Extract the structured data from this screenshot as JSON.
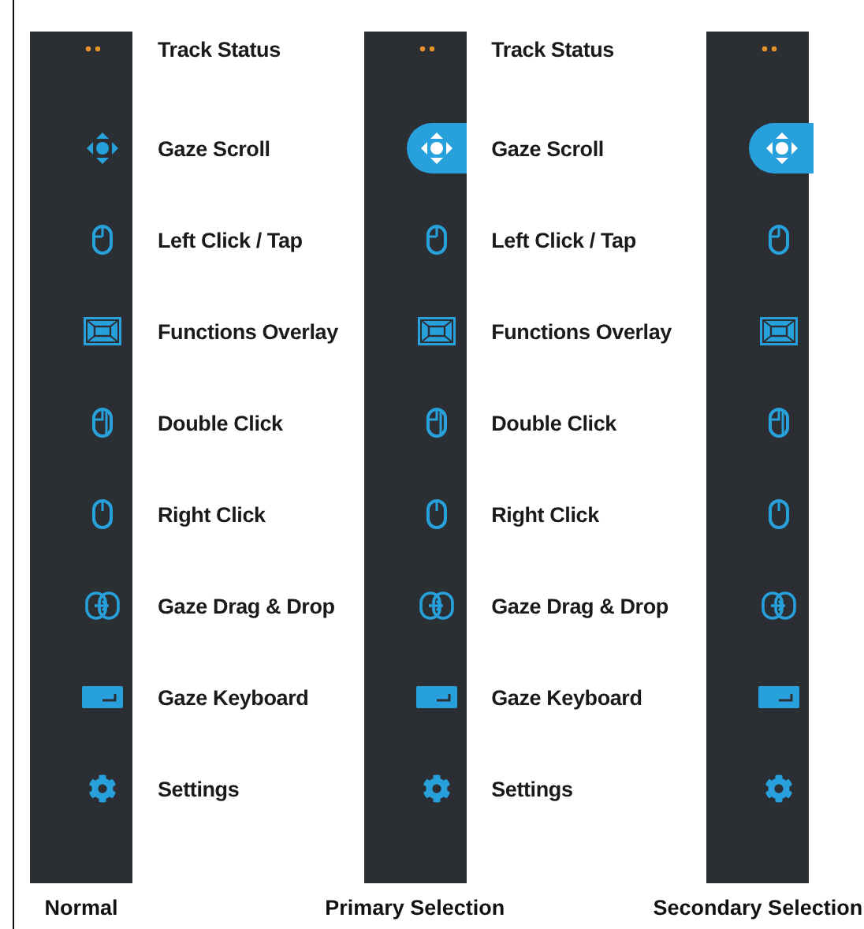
{
  "panels": [
    {
      "caption": "Normal",
      "kind": "normal",
      "items": [
        {
          "kind": "status",
          "label": "Track Status",
          "selected": false
        },
        {
          "kind": "scroll",
          "label": "Gaze Scroll",
          "selected": false
        },
        {
          "kind": "left-click",
          "label": "Left Click / Tap",
          "selected": false
        },
        {
          "kind": "overlay",
          "label": "Functions Overlay",
          "selected": false
        },
        {
          "kind": "double-click",
          "label": "Double Click",
          "selected": false
        },
        {
          "kind": "right-click",
          "label": "Right Click",
          "selected": false
        },
        {
          "kind": "drag-drop",
          "label": "Gaze Drag & Drop",
          "selected": false
        },
        {
          "kind": "keyboard",
          "label": "Gaze Keyboard",
          "selected": false
        },
        {
          "kind": "settings",
          "label": "Settings",
          "selected": false
        }
      ]
    },
    {
      "caption": "Primary Selection",
      "kind": "primary",
      "items": [
        {
          "kind": "status",
          "label": "Track Status",
          "selected": false
        },
        {
          "kind": "scroll",
          "label": "Gaze Scroll",
          "selected": true
        },
        {
          "kind": "left-click",
          "label": "Left Click / Tap",
          "selected": false
        },
        {
          "kind": "overlay",
          "label": "Functions Overlay",
          "selected": false
        },
        {
          "kind": "double-click",
          "label": "Double Click",
          "selected": false
        },
        {
          "kind": "right-click",
          "label": "Right Click",
          "selected": false
        },
        {
          "kind": "drag-drop",
          "label": "Gaze Drag & Drop",
          "selected": false
        },
        {
          "kind": "keyboard",
          "label": "Gaze Keyboard",
          "selected": false
        },
        {
          "kind": "settings",
          "label": "Settings",
          "selected": false
        }
      ]
    },
    {
      "caption": "Secondary Selection",
      "kind": "secondary",
      "items": [
        {
          "kind": "status",
          "selected": false
        },
        {
          "kind": "scroll",
          "selected": true
        },
        {
          "kind": "left-click",
          "selected": false
        },
        {
          "kind": "overlay",
          "selected": false
        },
        {
          "kind": "double-click",
          "selected": false
        },
        {
          "kind": "right-click",
          "selected": false
        },
        {
          "kind": "drag-drop",
          "selected": false
        },
        {
          "kind": "keyboard",
          "selected": false
        },
        {
          "kind": "settings",
          "selected": false
        }
      ]
    }
  ]
}
